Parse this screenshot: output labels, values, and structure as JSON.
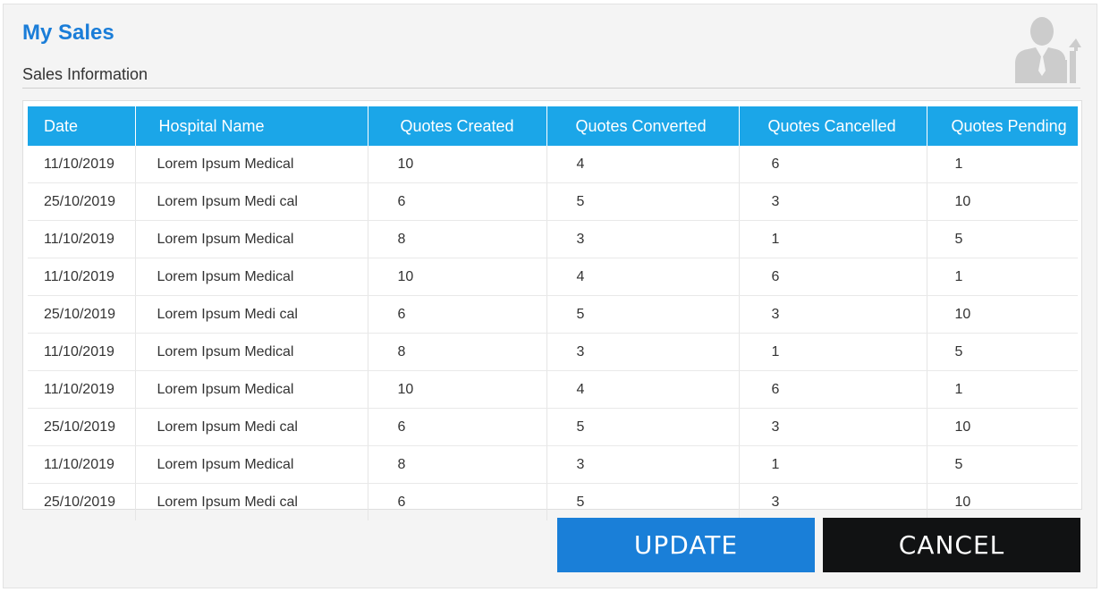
{
  "header": {
    "title": "My Sales",
    "subtitle": "Sales Information",
    "icon": "sales-person-chart-icon"
  },
  "table": {
    "columns": [
      "Date",
      "Hospital Name",
      "Quotes Created",
      "Quotes Converted",
      "Quotes Cancelled",
      "Quotes Pending"
    ],
    "rows": [
      [
        "11/10/2019",
        "Lorem Ipsum Medical",
        "10",
        "4",
        "6",
        "1"
      ],
      [
        "25/10/2019",
        "Lorem Ipsum Medi cal",
        "6",
        "5",
        "3",
        "10"
      ],
      [
        "11/10/2019",
        "Lorem Ipsum Medical",
        "8",
        "3",
        "1",
        "5"
      ],
      [
        "11/10/2019",
        "Lorem Ipsum Medical",
        "10",
        "4",
        "6",
        "1"
      ],
      [
        "25/10/2019",
        "Lorem Ipsum Medi cal",
        "6",
        "5",
        "3",
        "10"
      ],
      [
        "11/10/2019",
        "Lorem Ipsum Medical",
        "8",
        "3",
        "1",
        "5"
      ],
      [
        "11/10/2019",
        "Lorem Ipsum Medical",
        "10",
        "4",
        "6",
        "1"
      ],
      [
        "25/10/2019",
        "Lorem Ipsum Medi cal",
        "6",
        "5",
        "3",
        "10"
      ],
      [
        "11/10/2019",
        "Lorem Ipsum Medical",
        "8",
        "3",
        "1",
        "5"
      ],
      [
        "25/10/2019",
        "Lorem Ipsum Medi cal",
        "6",
        "5",
        "3",
        "10"
      ]
    ]
  },
  "actions": {
    "update_label": "UPDATE",
    "cancel_label": "CANCEL"
  },
  "colors": {
    "title": "#1a7dd8",
    "table_header": "#1ba6e8",
    "update_button": "#1a7fd8",
    "cancel_button": "#111213"
  }
}
